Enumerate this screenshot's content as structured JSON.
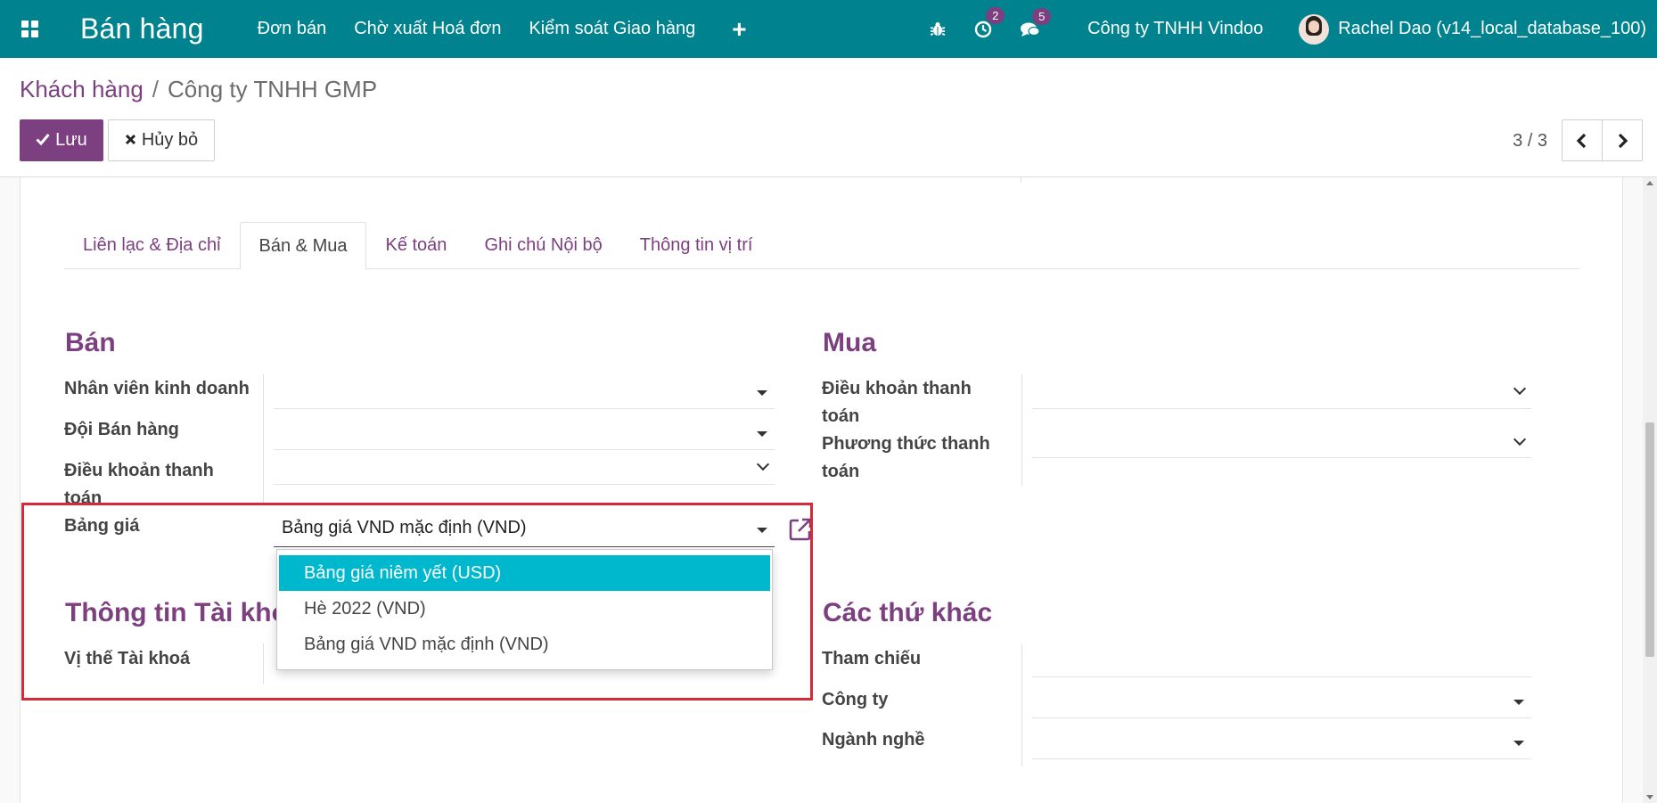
{
  "navbar": {
    "app_title": "Bán hàng",
    "menu": [
      "Đơn bán",
      "Chờ xuất Hoá đơn",
      "Kiểm soát Giao hàng"
    ],
    "plus_label": "+",
    "activity_count": "2",
    "message_count": "5",
    "company": "Công ty TNHH Vindoo",
    "user": "Rachel Dao (v14_local_database_100)"
  },
  "breadcrumb": {
    "parent": "Khách hàng",
    "separator": "/",
    "current": "Công ty TNHH GMP"
  },
  "actions": {
    "save_label": "Lưu",
    "cancel_label": "Hủy bỏ"
  },
  "pager": {
    "value": "3 / 3"
  },
  "tabs": [
    "Liên lạc & Địa chỉ",
    "Bán & Mua",
    "Kế toán",
    "Ghi chú Nội bộ",
    "Thông tin vị trí"
  ],
  "active_tab": "Bán & Mua",
  "sales": {
    "title": "Bán",
    "salesperson_label": "Nhân viên kinh doanh",
    "sales_team_label": "Đội Bán hàng",
    "payment_terms_label": "Điều khoản thanh toán",
    "pricelist_label": "Bảng giá",
    "pricelist_value": "Bảng giá VND mặc định (VND)"
  },
  "pricelist_options": [
    "Bảng giá niêm yết (USD)",
    "Hè 2022 (VND)",
    "Bảng giá VND mặc định (VND)"
  ],
  "purchase": {
    "title": "Mua",
    "payment_terms_label": "Điều khoản thanh toán",
    "payment_method_label": "Phương thức thanh toán"
  },
  "fiscal": {
    "title": "Thông tin Tài khoản",
    "fiscal_position_label": "Vị thế Tài khoá"
  },
  "misc": {
    "title": "Các thứ khác",
    "reference_label": "Tham chiếu",
    "company_label": "Công ty",
    "industry_label": "Ngành nghề"
  },
  "colors": {
    "navbar": "#00838f",
    "brand": "#7c3f80",
    "highlight": "#00b8ce",
    "annotation_box": "#d62a3a"
  }
}
